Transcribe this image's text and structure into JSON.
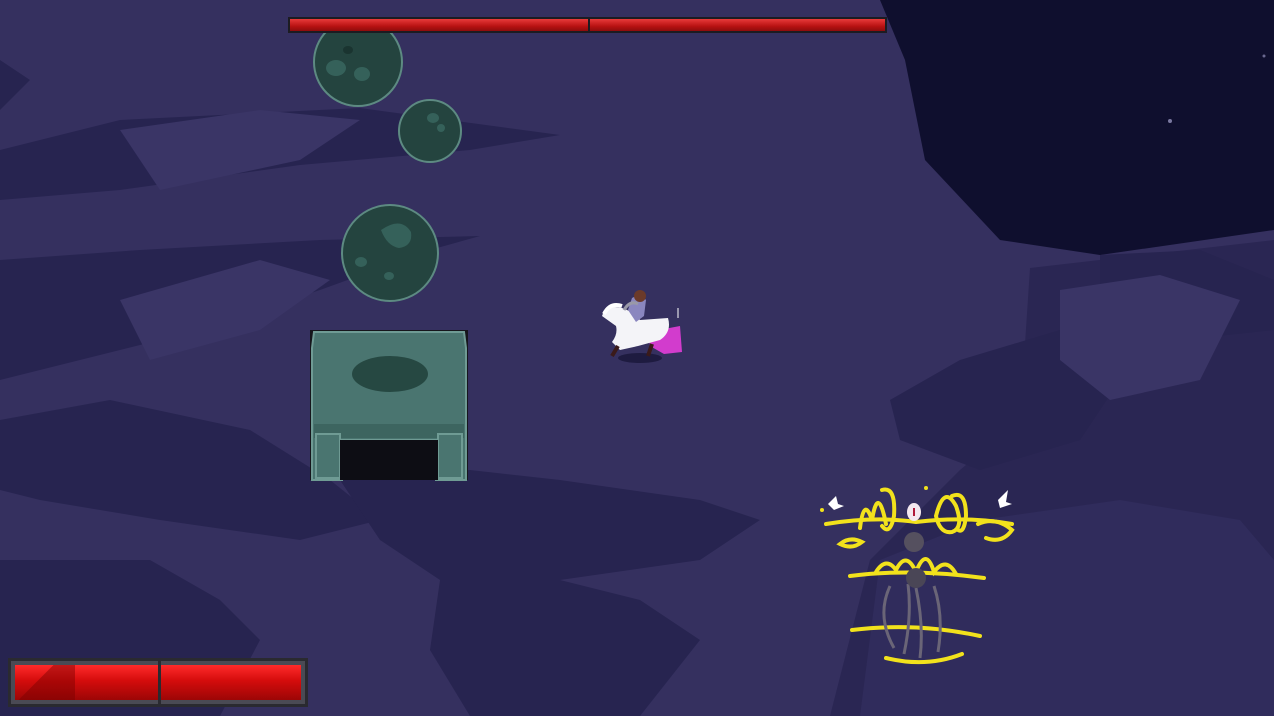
{
  "hud": {
    "boss_health": {
      "fraction": 1.0,
      "segments": 2,
      "fill_color": "#d81a1a"
    },
    "player_health": {
      "fraction": 1.0,
      "segments": 2,
      "fill_color": "#e00e0e"
    }
  },
  "scene": {
    "colors": {
      "void": "#0f0f2e",
      "ground": "#35305f",
      "ground_shadow": "#272450",
      "ruin_stone": "#4a7570",
      "boulder": "#24443f",
      "boss_glow": "#f2e21c"
    },
    "entities": [
      {
        "name": "player-hero-icon",
        "kind": "hero with magenta cape riding white mount"
      },
      {
        "name": "boss-enemy-icon",
        "kind": "yellow-outlined spectral boss"
      },
      {
        "name": "stone-shrine-icon",
        "kind": "green stone ruin with dark doorway"
      },
      {
        "name": "boulder-icon",
        "kind": "dark green round rocks"
      }
    ]
  }
}
